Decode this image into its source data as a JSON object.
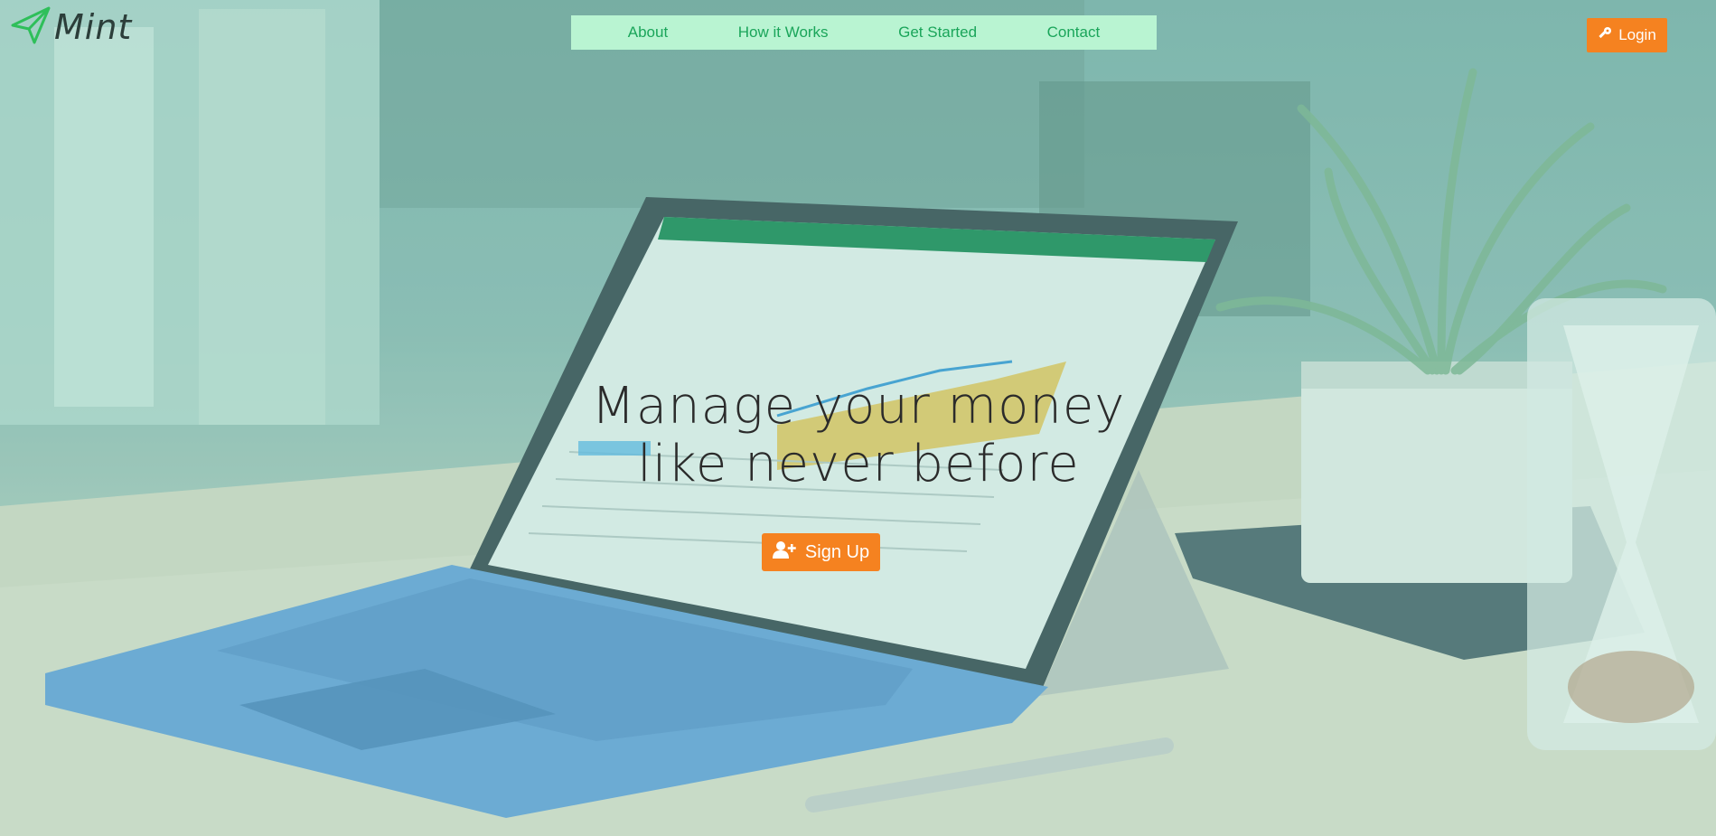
{
  "brand": {
    "name": "Mint",
    "icon": "paper-plane-icon"
  },
  "nav": {
    "items": [
      {
        "label": "About"
      },
      {
        "label": "How it Works"
      },
      {
        "label": "Get Started"
      },
      {
        "label": "Contact"
      }
    ]
  },
  "login": {
    "label": "Login",
    "icon": "key-icon"
  },
  "hero": {
    "headline_line1": "Manage your money",
    "headline_line2": "like never before",
    "signup_label": "Sign Up",
    "signup_icon": "user-plus-icon"
  },
  "colors": {
    "accent": "#f58220",
    "nav_background": "#b9f4d2",
    "nav_text": "#1aa55a",
    "brand_icon": "#2fbf5a"
  }
}
